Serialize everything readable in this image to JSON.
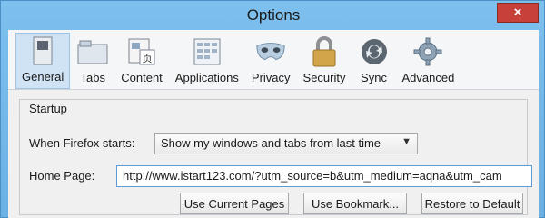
{
  "window": {
    "title": "Options",
    "close_label": "×"
  },
  "tabs": [
    {
      "label": "General",
      "icon": "switch-icon"
    },
    {
      "label": "Tabs",
      "icon": "folder-tabs-icon"
    },
    {
      "label": "Content",
      "icon": "content-icon"
    },
    {
      "label": "Applications",
      "icon": "applications-icon"
    },
    {
      "label": "Privacy",
      "icon": "mask-icon"
    },
    {
      "label": "Security",
      "icon": "padlock-icon"
    },
    {
      "label": "Sync",
      "icon": "sync-icon"
    },
    {
      "label": "Advanced",
      "icon": "gear-icon"
    }
  ],
  "startup": {
    "group_label": "Startup",
    "when_label": "When Firefox starts:",
    "when_value": "Show my windows and tabs from last time",
    "home_label": "Home Page:",
    "home_value": "http://www.istart123.com/?utm_source=b&utm_medium=aqna&utm_cam",
    "buttons": {
      "use_current": "Use Current Pages",
      "use_bookmark": "Use Bookmark...",
      "restore_default": "Restore to Default"
    }
  },
  "colors": {
    "accent": "#6ab0e3",
    "active_tab": "#cfe3f5",
    "close": "#c7413b"
  }
}
